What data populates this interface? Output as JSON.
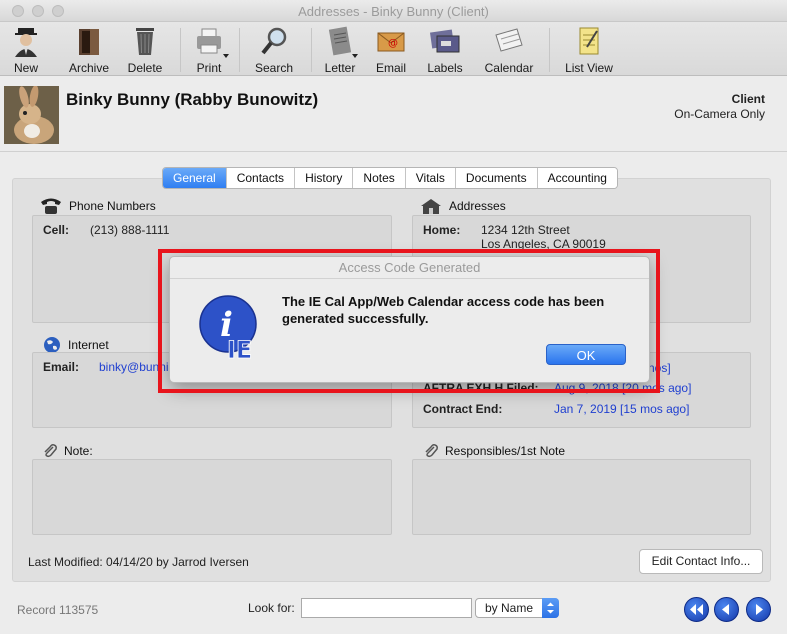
{
  "window": {
    "title": "Addresses - Binky Bunny (Client)"
  },
  "toolbar": {
    "items": [
      {
        "label": "New",
        "icon": "new-person-icon"
      },
      {
        "label": "Archive",
        "icon": "archive-box-icon"
      },
      {
        "label": "Delete",
        "icon": "trash-can-icon"
      },
      {
        "label": "Print",
        "icon": "printer-icon"
      },
      {
        "label": "Search",
        "icon": "magnifier-icon"
      },
      {
        "label": "Letter",
        "icon": "letter-icon"
      },
      {
        "label": "Email",
        "icon": "email-envelope-icon"
      },
      {
        "label": "Labels",
        "icon": "labels-envelope-icon"
      },
      {
        "label": "Calendar",
        "icon": "calendar-icon"
      },
      {
        "label": "List View",
        "icon": "list-notepad-icon"
      }
    ]
  },
  "contact": {
    "name": "Binky Bunny (Rabby Bunowitz)",
    "type": "Client",
    "subtype": "On-Camera Only"
  },
  "tabs": [
    "General",
    "Contacts",
    "History",
    "Notes",
    "Vitals",
    "Documents",
    "Accounting"
  ],
  "active_tab": "General",
  "phone": {
    "title": "Phone Numbers",
    "label": "Cell:",
    "value": "(213) 888-1111"
  },
  "addresses": {
    "title": "Addresses",
    "label": "Home:",
    "line1": "1234 12th Street",
    "line2": "Los Angeles, CA 90019"
  },
  "internet": {
    "title": "Internet",
    "label": "Email:",
    "value": "binky@bunni"
  },
  "vitals": {
    "partial_value": "nos]",
    "aftra_label": "AFTRA EXH H Filed:",
    "aftra_value": "Aug 9, 2018 [20 mos ago]",
    "contract_label": "Contract End:",
    "contract_value": "Jan 7, 2019 [15 mos ago]"
  },
  "note": {
    "title": "Note:"
  },
  "responsibles": {
    "title": "Responsibles/1st Note"
  },
  "footer": {
    "last_modified": "Last Modified: 04/14/20 by Jarrod Iversen",
    "edit_button": "Edit Contact Info...",
    "record": "Record 113575",
    "look_for": "Look for:",
    "search_value": "",
    "search_by": "by Name"
  },
  "dialog": {
    "title": "Access Code Generated",
    "message": "The IE Cal App/Web Calendar access code has been generated successfully.",
    "ok_label": "OK",
    "icon": "ie-info-icon"
  },
  "colors": {
    "highlight_frame": "#e8141c",
    "accent_blue": "#2f7ef2",
    "link_blue": "#1f3fd0"
  }
}
